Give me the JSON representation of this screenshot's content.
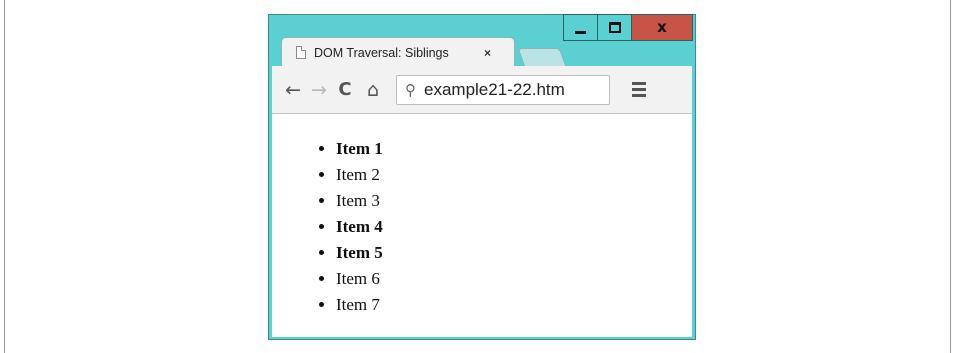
{
  "window": {
    "controls": {
      "minimize": "minimize-icon",
      "maximize": "maximize-icon",
      "close": "close-icon",
      "close_glyph": "x"
    }
  },
  "tab": {
    "title": "DOM Traversal: Siblings",
    "close": "×",
    "icon": "page-icon"
  },
  "toolbar": {
    "back": "←",
    "forward": "→",
    "reload": "C",
    "home": "⌂",
    "search_icon": "⚲",
    "url": "example21-22.htm",
    "menu_icon": "hamburger-menu-icon"
  },
  "list": {
    "items": [
      {
        "label": "Item 1",
        "bold": true
      },
      {
        "label": "Item 2",
        "bold": false
      },
      {
        "label": "Item 3",
        "bold": false
      },
      {
        "label": "Item 4",
        "bold": true
      },
      {
        "label": "Item 5",
        "bold": true
      },
      {
        "label": "Item 6",
        "bold": false
      },
      {
        "label": "Item 7",
        "bold": false
      }
    ]
  },
  "colors": {
    "window_frame": "#5bd0d2",
    "close_button": "#c65447"
  }
}
